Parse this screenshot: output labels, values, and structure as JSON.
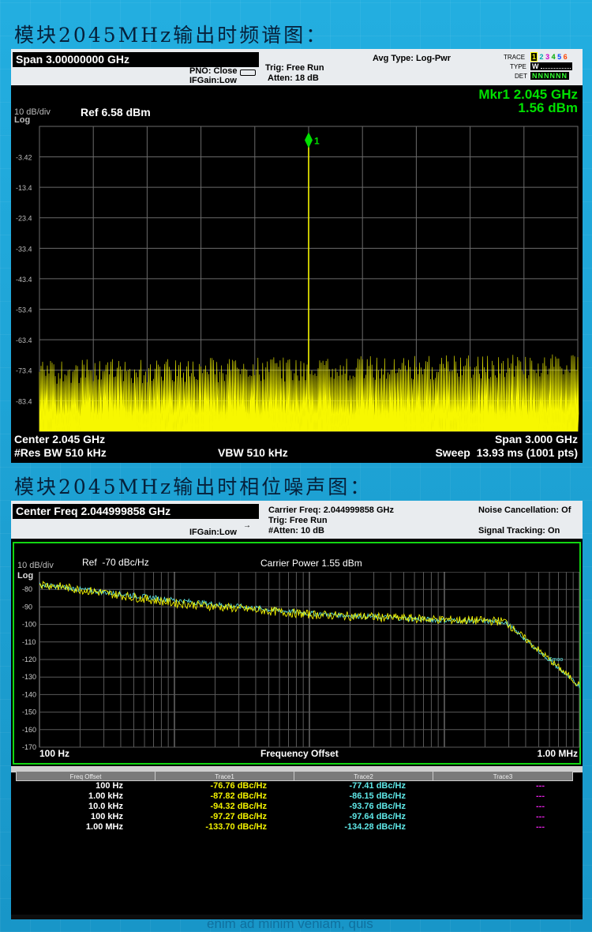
{
  "headings": {
    "spectrum": "模块2045MHz输出时频谱图：",
    "phase_noise": "模块2045MHz输出时相位噪声图："
  },
  "spectrum": {
    "header": {
      "span": "Span 3.00000000 GHz",
      "pno": "PNO: Close",
      "ifgain": "IFGain:Low",
      "trig": "Trig: Free Run",
      "atten": "Atten: 18 dB",
      "avg_type": "Avg Type: Log-Pwr",
      "trace_label": "TRACE",
      "type_label": "TYPE",
      "det_label": "DET",
      "trace_nums": [
        "1",
        "2",
        "3",
        "4",
        "5",
        "6"
      ],
      "type_value": "W",
      "det_values": [
        "N",
        "N",
        "N",
        "N",
        "N",
        "N"
      ]
    },
    "scale": "10 dB/div",
    "log_label": "Log",
    "ref": "Ref 6.58 dBm",
    "marker": {
      "line1": "Mkr1 2.045 GHz",
      "line2": "1.56 dBm",
      "label": "1"
    },
    "y_ticks": [
      "-3.42",
      "-13.4",
      "-23.4",
      "-33.4",
      "-43.4",
      "-53.4",
      "-63.4",
      "-73.4",
      "-83.4"
    ],
    "footer": {
      "center": "Center 2.045 GHz",
      "span": "Span 3.000 GHz",
      "res_bw": "#Res BW 510 kHz",
      "vbw": "VBW 510 kHz",
      "sweep": "Sweep  13.93 ms (1001 pts)"
    },
    "colors": {
      "trace": "#f7f700",
      "marker": "#00e000",
      "grid": "#6b6b6b"
    }
  },
  "phase_noise": {
    "header": {
      "center_freq": "Center Freq 2.044999858 GHz",
      "ifgain": "IFGain:Low",
      "carrier_freq": "Carrier Freq: 2.044999858 GHz",
      "trig": "Trig: Free Run",
      "atten": "#Atten: 10 dB",
      "noise_cancel": "Noise Cancellation: Of",
      "signal_tracking": "Signal Tracking: On"
    },
    "scale": "10 dB/div",
    "log_label": "Log",
    "ref": "Ref  -70 dBc/Hz",
    "carrier_power": "Carrier Power 1.55 dBm",
    "y_ticks": [
      "-80",
      "-90",
      "-100",
      "-110",
      "-120",
      "-130",
      "-140",
      "-150",
      "-160",
      "-170"
    ],
    "x_left": "100 Hz",
    "x_center": "Frequency Offset",
    "x_right": "1.00 MHz",
    "smoothed_label": "Smoo",
    "colors": {
      "trace1": "#f2f200",
      "trace2": "#5fe8e8",
      "frame": "#12d612"
    }
  },
  "table": {
    "columns": [
      "Freq Offset",
      "Trace1",
      "Trace2",
      "Trace3"
    ],
    "rows": [
      {
        "offset": "100 Hz",
        "trace1": "-76.76 dBc/Hz",
        "trace2": "-77.41 dBc/Hz",
        "trace3": "---"
      },
      {
        "offset": "1.00 kHz",
        "trace1": "-87.82 dBc/Hz",
        "trace2": "-86.15 dBc/Hz",
        "trace3": "---"
      },
      {
        "offset": "10.0 kHz",
        "trace1": "-94.32 dBc/Hz",
        "trace2": "-93.76 dBc/Hz",
        "trace3": "---"
      },
      {
        "offset": "100 kHz",
        "trace1": "-97.27 dBc/Hz",
        "trace2": "-97.64 dBc/Hz",
        "trace3": "---"
      },
      {
        "offset": "1.00 MHz",
        "trace1": "-133.70 dBc/Hz",
        "trace2": "-134.28 dBc/Hz",
        "trace3": "---"
      }
    ]
  },
  "footer_watermark": "enim ad minim veniam, quis"
}
